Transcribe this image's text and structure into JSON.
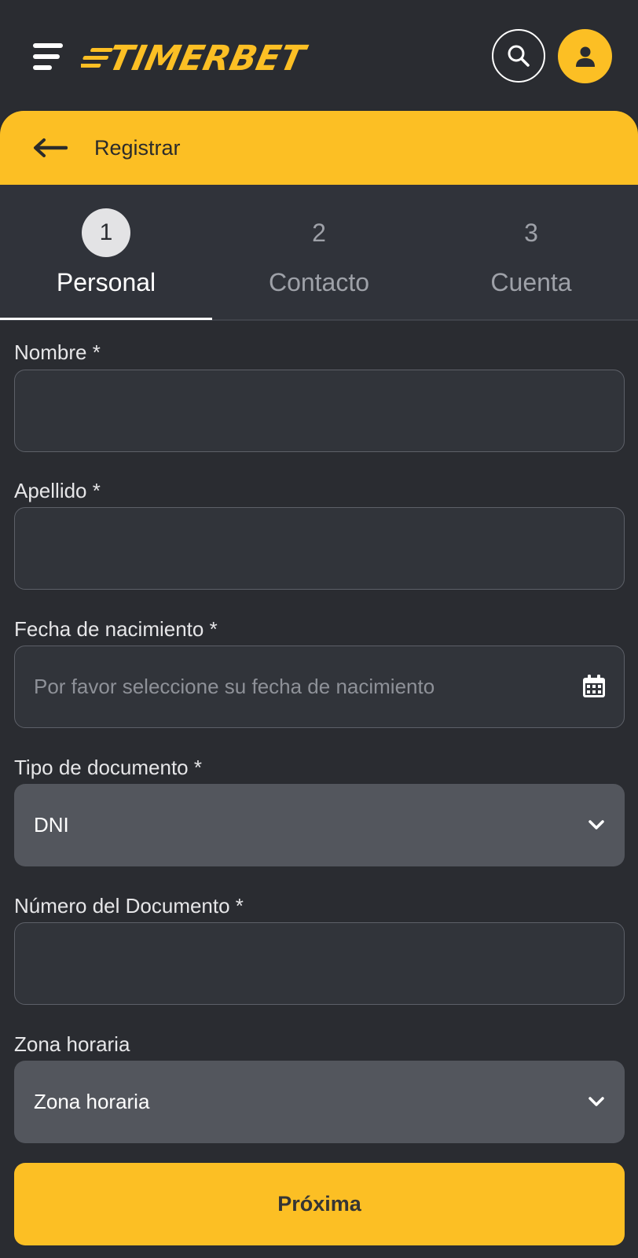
{
  "header": {
    "logo_text": "TIMERBET",
    "brand_color": "#fcbf24",
    "icons": {
      "menu": "hamburger-menu-icon",
      "search": "search-icon",
      "user": "user-icon"
    }
  },
  "titlebar": {
    "back_icon": "arrow-left-icon",
    "title": "Registrar"
  },
  "steps": [
    {
      "number": "1",
      "label": "Personal",
      "active": true
    },
    {
      "number": "2",
      "label": "Contacto",
      "active": false
    },
    {
      "number": "3",
      "label": "Cuenta",
      "active": false
    }
  ],
  "form": {
    "nombre": {
      "label": "Nombre *",
      "value": ""
    },
    "apellido": {
      "label": "Apellido *",
      "value": ""
    },
    "fecha": {
      "label": "Fecha de nacimiento *",
      "placeholder": "Por favor seleccione su fecha de nacimiento",
      "icon": "calendar-icon"
    },
    "tipo_documento": {
      "label": "Tipo de documento *",
      "selected": "DNI"
    },
    "numero_documento": {
      "label": "Número del Documento *",
      "value": ""
    },
    "zona_horaria": {
      "label": "Zona horaria",
      "selected": "Zona horaria"
    },
    "next_label": "Próxima"
  }
}
